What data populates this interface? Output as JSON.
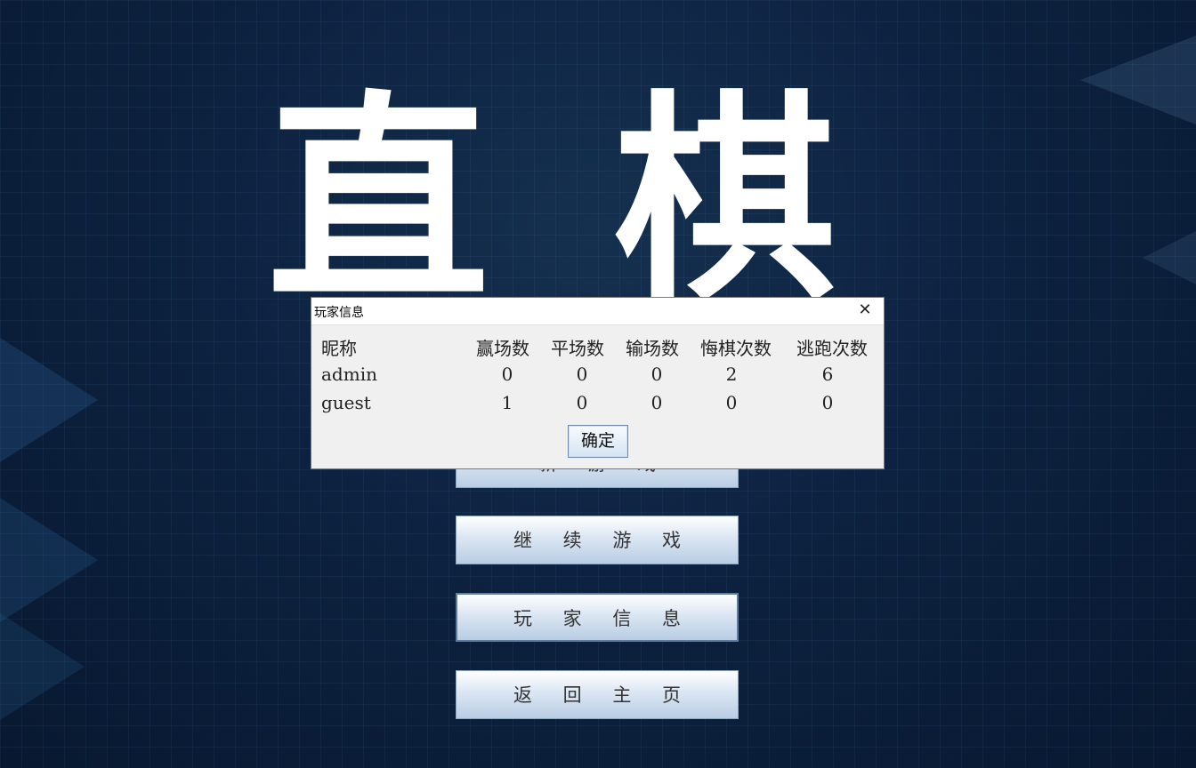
{
  "title": {
    "char1": "直",
    "char2": "棋"
  },
  "menu": {
    "buttons": [
      {
        "label": "新 游 戏"
      },
      {
        "label": "继 续 游 戏"
      },
      {
        "label": "玩 家 信 息"
      },
      {
        "label": "返 回 主 页"
      }
    ]
  },
  "dialog": {
    "title": "玩家信息",
    "close_icon": "close-icon",
    "headers": [
      "昵称",
      "赢场数",
      "平场数",
      "输场数",
      "悔棋次数",
      "逃跑次数"
    ],
    "rows": [
      {
        "name": "admin",
        "wins": "0",
        "draws": "0",
        "losses": "0",
        "undos": "2",
        "escapes": "6"
      },
      {
        "name": "guest",
        "wins": "1",
        "draws": "0",
        "losses": "0",
        "undos": "0",
        "escapes": "0"
      }
    ],
    "ok_label": "确定"
  },
  "colors": {
    "background": "#0d2240",
    "dialog_bg": "#f0f0f0",
    "button_gradient_end": "#b9cde4"
  }
}
